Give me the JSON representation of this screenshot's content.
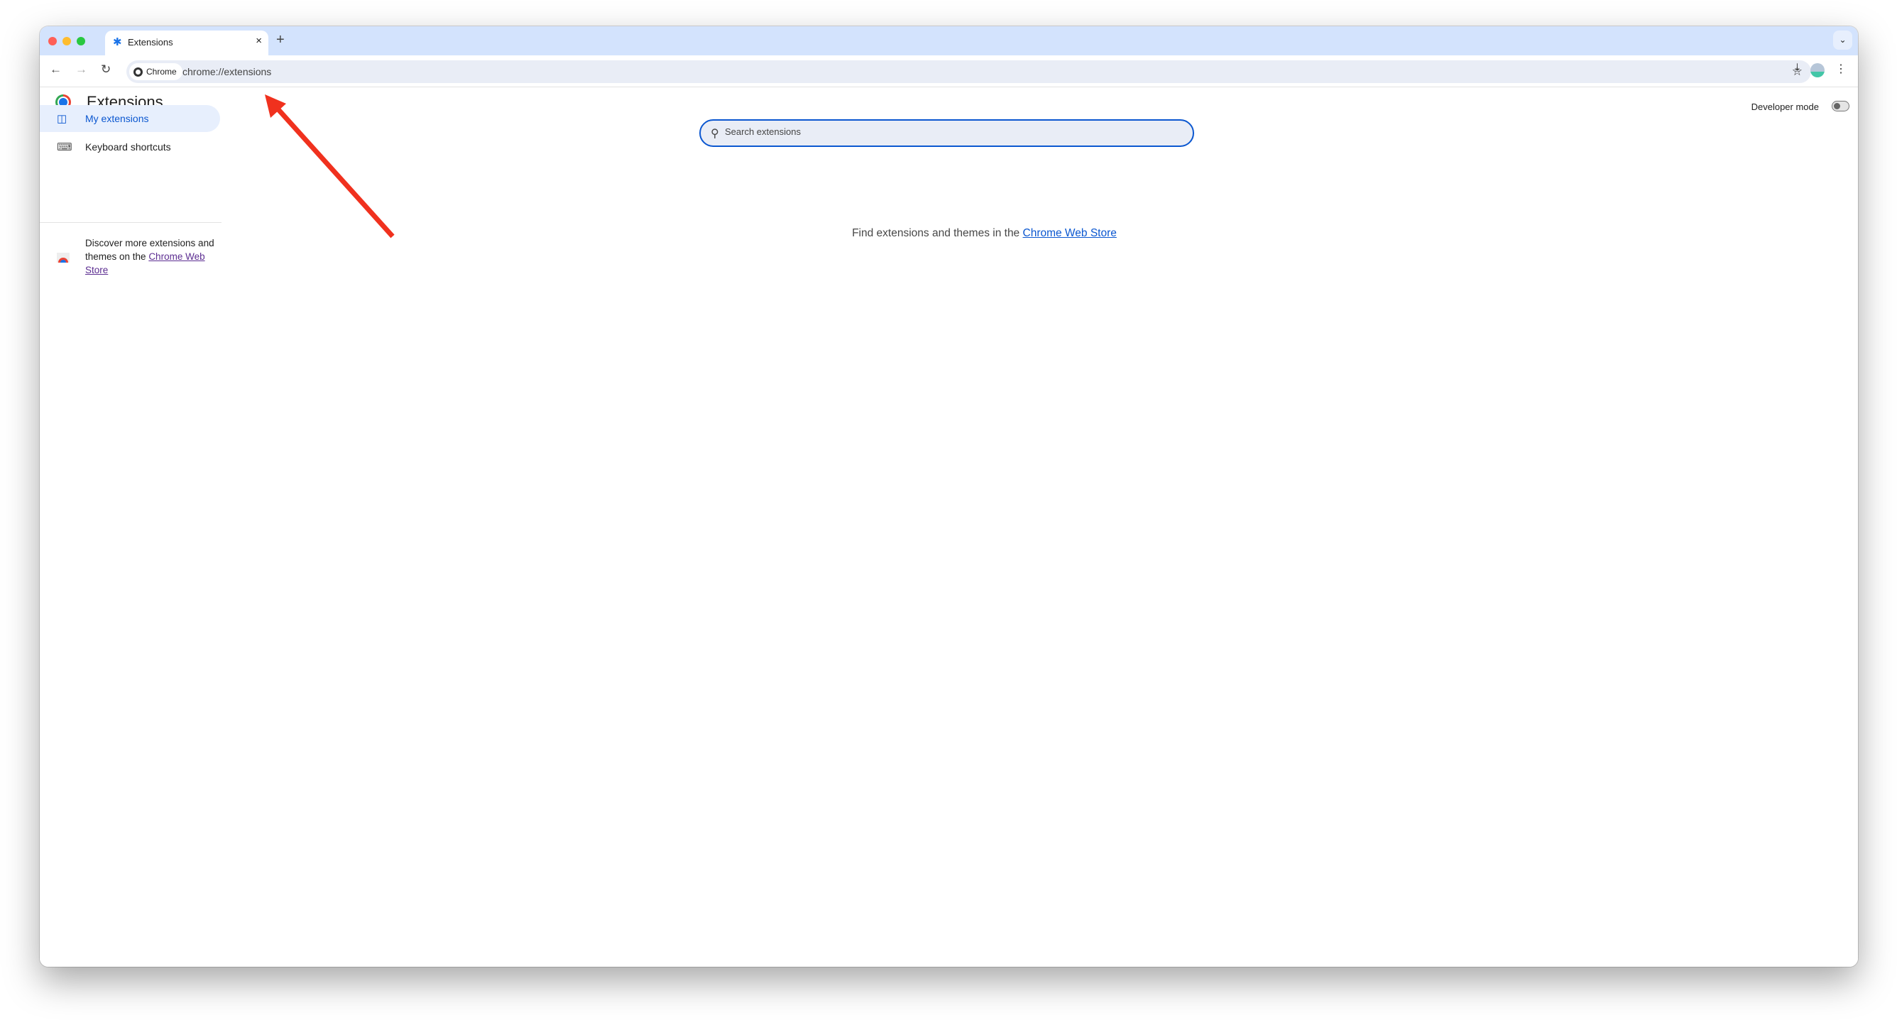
{
  "browser": {
    "tab": {
      "title": "Extensions",
      "icon": "puzzle-icon",
      "close_label": "×"
    },
    "new_tab_label": "+",
    "tab_search_label": "⌄",
    "omnibox": {
      "chip_label": "Chrome",
      "url": "chrome://extensions"
    },
    "icons": {
      "back": "←",
      "forward": "→",
      "reload": "↻",
      "star": "☆",
      "download": "⤓",
      "menu": "⋮"
    }
  },
  "page": {
    "title": "Extensions",
    "search": {
      "placeholder": "Search extensions",
      "value": ""
    },
    "developer_mode": {
      "label": "Developer mode",
      "enabled": false
    },
    "sidebar": {
      "items": [
        {
          "label": "My extensions",
          "icon": "puzzle-outline-icon",
          "active": true
        },
        {
          "label": "Keyboard shortcuts",
          "icon": "keyboard-icon",
          "active": false
        }
      ],
      "discover": {
        "prefix": "Discover more extensions and themes on the ",
        "link": "Chrome Web Store"
      }
    },
    "empty_state": {
      "prefix": "Find extensions and themes in the ",
      "link": "Chrome Web Store"
    }
  },
  "annotation": {
    "color": "#f0311e"
  }
}
